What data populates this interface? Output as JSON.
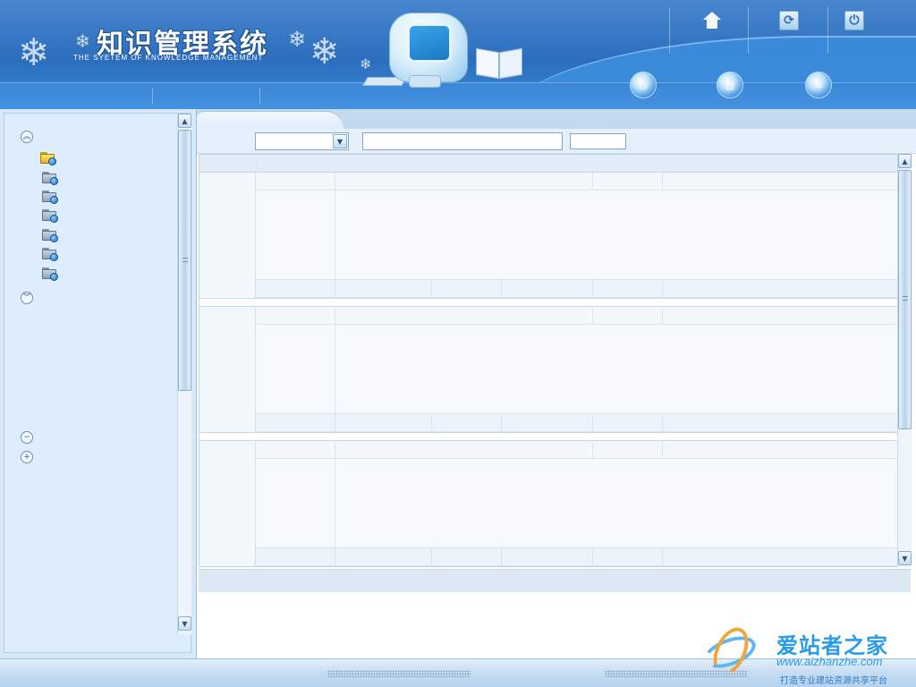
{
  "header": {
    "title_cn": "知识管理系统",
    "title_en": "THE SYETEM OF KNOWLEDGE MANAGEMENT",
    "top_icons": [
      "home-icon",
      "refresh-icon",
      "logout-icon"
    ],
    "round_icons": [
      "network-icon",
      "library-icon",
      "help-icon"
    ]
  },
  "sidebar": {
    "expand_all_icon": "double-chevron-up-icon",
    "collapse_all_icon": "double-chevron-down-icon",
    "folders": [
      "folder-open-icon",
      "folder-icon",
      "folder-icon",
      "folder-icon",
      "folder-icon",
      "folder-icon",
      "folder-icon"
    ],
    "minus_icon": "minus-icon",
    "plus_icon": "plus-icon"
  },
  "main": {
    "tab_label": "",
    "select_value": "",
    "search_value": "",
    "search_button_label": ""
  },
  "watermark": {
    "title": "爱站者之家",
    "url": "www.aizhanzhe.com",
    "slogan": "打造专业建站资源共享平台"
  },
  "colors": {
    "header_blue": "#2f76c7",
    "panel_bg": "#d7e8f8",
    "accent_light": "#e6f0fb"
  }
}
